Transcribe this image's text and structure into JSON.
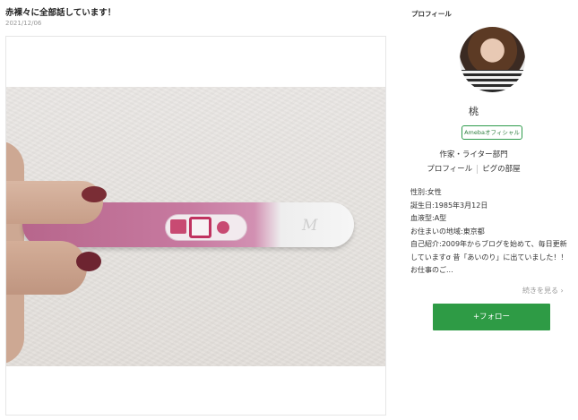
{
  "post": {
    "title": "赤裸々に全部話しています！",
    "date": "2021/12/06"
  },
  "test_logo_text": "M",
  "profile": {
    "heading": "プロフィール",
    "name": "桃",
    "badge": "Amebaオフィシャル",
    "role": "作家・ライター部門",
    "links": [
      "プロフィール",
      "ピグの部屋"
    ],
    "details": [
      "性別:女性",
      "誕生日:1985年3月12日",
      "血液型:A型",
      "お住まいの地域:東京都"
    ],
    "bio": "自己紹介:2009年からブログを始めて、毎日更新していますσ 昔「あいのり」に出ていました！！ お仕事のご...",
    "read_more": "続きを見る ›",
    "follow": "+フォロー"
  },
  "colors": {
    "follow_green": "#2e9b45",
    "badge_green": "#2e9b4c"
  }
}
